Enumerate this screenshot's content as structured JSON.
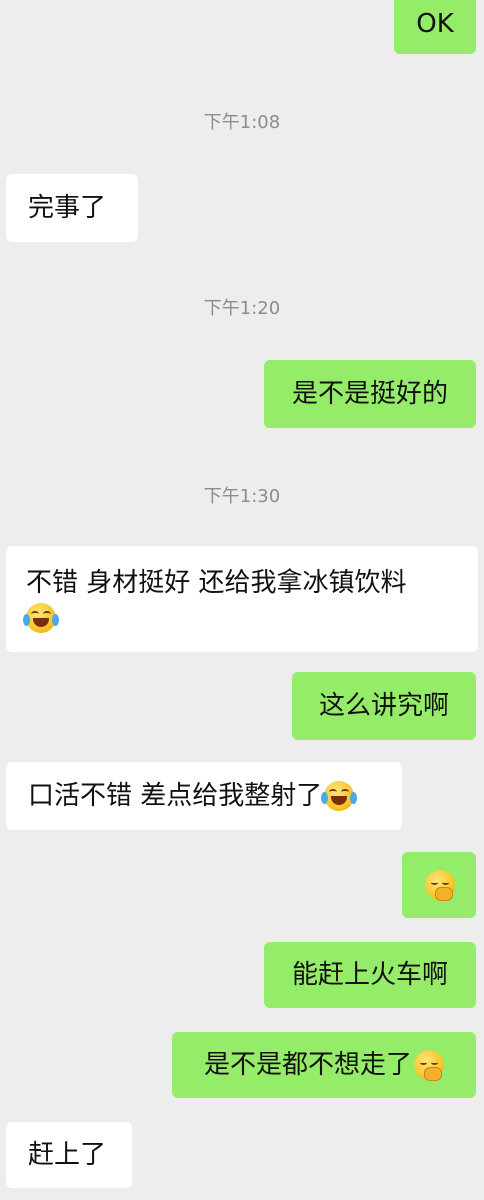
{
  "colors": {
    "background": "#ededed",
    "sent_bubble": "#95ec69",
    "received_bubble": "#ffffff",
    "timestamp": "#8c8c8c"
  },
  "messages": [
    {
      "kind": "sent",
      "text": "OK"
    },
    {
      "kind": "time",
      "text": "下午1:08"
    },
    {
      "kind": "received",
      "text": "完事了"
    },
    {
      "kind": "time",
      "text": "下午1:20"
    },
    {
      "kind": "sent",
      "text": "是不是挺好的"
    },
    {
      "kind": "time",
      "text": "下午1:30"
    },
    {
      "kind": "received",
      "text": "不错 身材挺好 还给我拿冰镇饮料",
      "emoji": "laugh-cry-emoji"
    },
    {
      "kind": "sent",
      "text": "这么讲究啊"
    },
    {
      "kind": "received",
      "text": "口活不错 差点给我整射了",
      "emoji": "laugh-cry-emoji"
    },
    {
      "kind": "sent",
      "text": "",
      "emoji": "smirk-emoji"
    },
    {
      "kind": "sent",
      "text": "能赶上火车啊"
    },
    {
      "kind": "sent",
      "text": "是不是都不想走了",
      "emoji": "smirk-emoji"
    },
    {
      "kind": "received",
      "text": "赶上了"
    }
  ]
}
